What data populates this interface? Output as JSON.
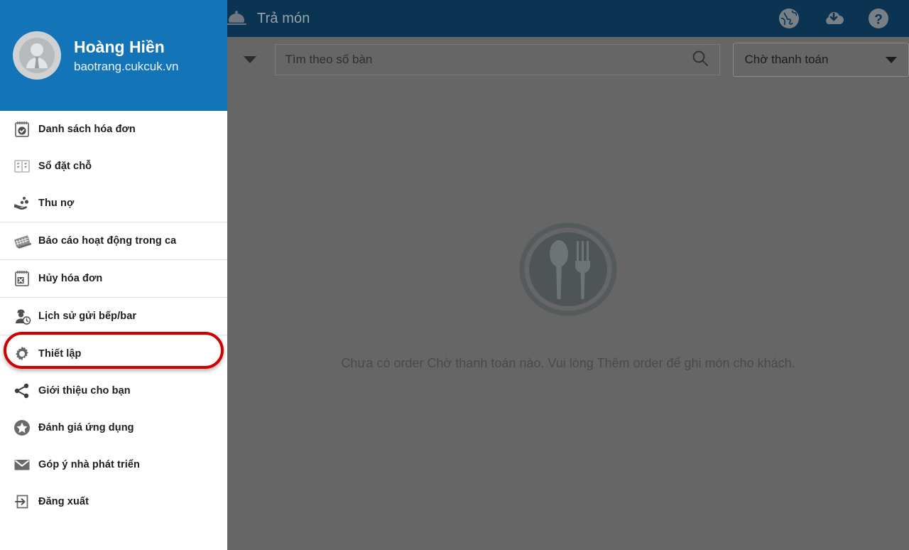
{
  "topbar": {
    "icon": "cloche-icon",
    "title": "Trả món",
    "actions": [
      {
        "name": "globe-icon",
        "label": "globe-icon"
      },
      {
        "name": "cloud-download-icon",
        "label": "cloud-download-icon"
      },
      {
        "name": "help-icon",
        "label": "help-icon"
      }
    ],
    "bg_color": "#0b3352"
  },
  "search": {
    "filter_caret": "chevron-down-icon",
    "placeholder": "Tìm theo số bàn",
    "value": "",
    "search_icon": "search-icon",
    "status_select": {
      "value": "Chờ thanh toán",
      "caret": "chevron-down-icon"
    }
  },
  "main": {
    "empty_icon": "plate-spoon-fork-icon",
    "empty_message": "Chưa có order Chờ thanh toán nào. Vui lòng Thêm order để ghi món cho khách.",
    "dim_color": "#666666"
  },
  "drawer": {
    "header": {
      "avatar": "user-avatar-icon",
      "name": "Hoàng Hiền",
      "domain": "baotrang.cukcuk.vn",
      "bg_color": "#1374b8"
    },
    "items": [
      {
        "icon": "invoice-list-icon",
        "label": "Danh sách hóa đơn",
        "divider_after": false
      },
      {
        "icon": "reservation-book-icon",
        "label": "Sổ đặt chỗ",
        "divider_after": false
      },
      {
        "icon": "debt-collection-icon",
        "label": "Thu nợ",
        "divider_after": true
      },
      {
        "icon": "shift-report-icon",
        "label": "Báo cáo hoạt động trong ca",
        "divider_after": true
      },
      {
        "icon": "cancel-invoice-icon",
        "label": "Hủy hóa đơn",
        "divider_after": true
      },
      {
        "icon": "kitchen-history-icon",
        "label": "Lịch sử gửi bếp/bar",
        "divider_after": true
      },
      {
        "icon": "gear-icon",
        "label": "Thiết lập",
        "divider_after": false
      },
      {
        "icon": "share-icon",
        "label": "Giới thiệu cho bạn",
        "divider_after": false
      },
      {
        "icon": "star-rate-icon",
        "label": "Đánh giá ứng dụng",
        "divider_after": false
      },
      {
        "icon": "mail-icon",
        "label": "Góp ý nhà phát triển",
        "divider_after": false
      },
      {
        "icon": "logout-icon",
        "label": "Đăng xuất",
        "divider_after": false
      }
    ],
    "highlight": {
      "target_label": "Thiết lập",
      "color": "#d10000"
    }
  }
}
